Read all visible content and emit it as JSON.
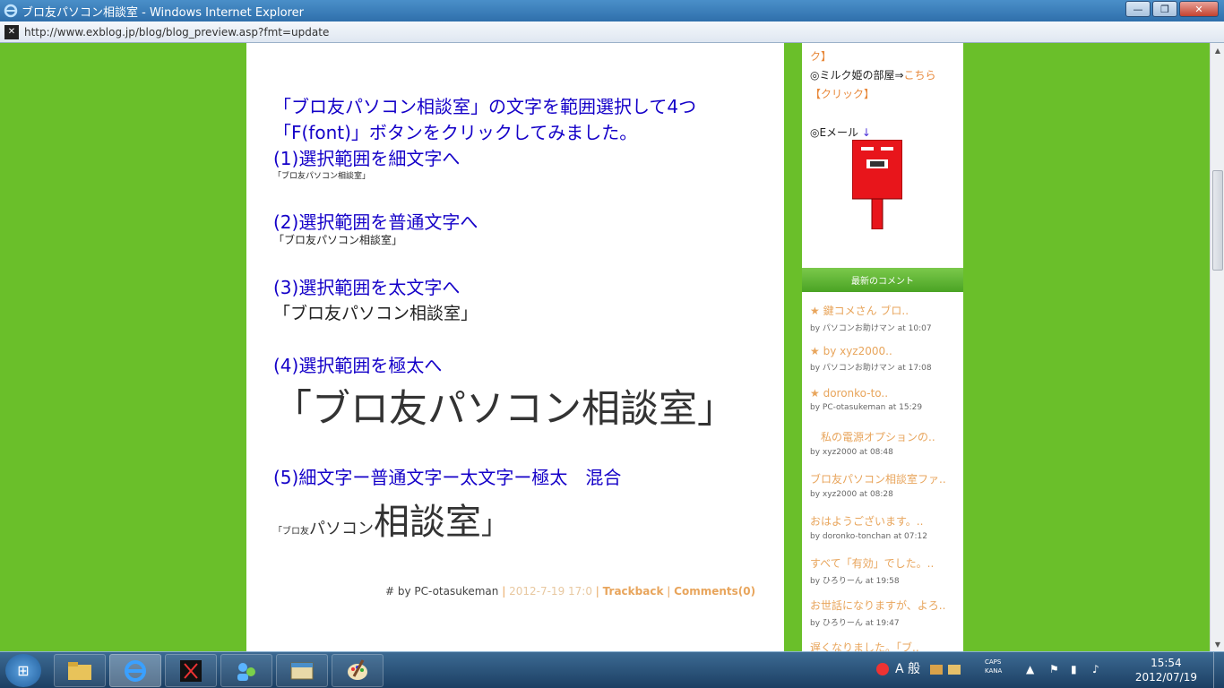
{
  "window": {
    "title": "ブロ友パソコン相談室 - Windows Internet Explorer",
    "url": "http://www.exblog.jp/blog/blog_preview.asp?fmt=update"
  },
  "article": {
    "intro1": "「ブロ友パソコン相談室」の文字を範囲選択して4つ",
    "intro2": "「F(font)」ボタンをクリックしてみました。",
    "h1": "(1)選択範囲を細文字へ",
    "s1": "「ブロ友パソコン相談室」",
    "h2": "(2)選択範囲を普通文字へ",
    "s2": "「ブロ友パソコン相談室」",
    "h3": "(3)選択範囲を太文字へ",
    "s3": "「ブロ友パソコン相談室」",
    "h4": "(4)選択範囲を極太へ",
    "s4": "「ブロ友パソコン相談室」",
    "h5": "(5)細文字ー普通文字ー太文字ー極太　混合",
    "mix_a": "「ブロ友",
    "mix_b": "パソコン",
    "mix_c": "相談室",
    "mix_d": "」",
    "footer_prefix": "# by PC-otasukeman",
    "footer_sep1": "|",
    "footer_date": "2012-7-19 17:0",
    "footer_sep2": "|",
    "footer_trackback": "Trackback",
    "footer_sep3": "|",
    "footer_comments": "Comments(0)"
  },
  "sidebar": {
    "top_fragment": "ク】",
    "milk_prefix": "◎ミルク姫の部屋⇒",
    "milk_link": "こちら",
    "click": "【クリック】",
    "email": "◎Eメール",
    "email_arrow": "↓",
    "comments_header": "最新のコメント",
    "comments": [
      {
        "title": "★ 鍵コメさん ブロ..",
        "by": "by パソコンお助けマン at 10:07"
      },
      {
        "title": "★ by xyz2000..",
        "by": "by パソコンお助けマン at 17:08"
      },
      {
        "title": "★ doronko-to..",
        "by": "by PC-otasukeman at 15:29"
      },
      {
        "title": "　私の電源オプションの..",
        "by": "by xyz2000 at 08:48"
      },
      {
        "title": "ブロ友パソコン相談室ファ..",
        "by": "by xyz2000 at 08:28"
      },
      {
        "title": "おはようございます。..",
        "by": "by doronko-tonchan at 07:12"
      },
      {
        "title": "すべて「有効」でした。..",
        "by": "by ひろりーん at 19:58"
      },
      {
        "title": "お世話になりますが、よろ..",
        "by": "by ひろりーん at 19:47"
      },
      {
        "title": "遅くなりました。「ブ..",
        "by": ""
      }
    ]
  },
  "taskbar": {
    "ime_label": "A 般",
    "caps": "CAPS",
    "kana": "KANA",
    "time": "15:54",
    "date": "2012/07/19"
  },
  "colors": {
    "page_green": "#6abf2a",
    "heading_blue": "#1400c8",
    "link_orange": "#e8a55c"
  }
}
